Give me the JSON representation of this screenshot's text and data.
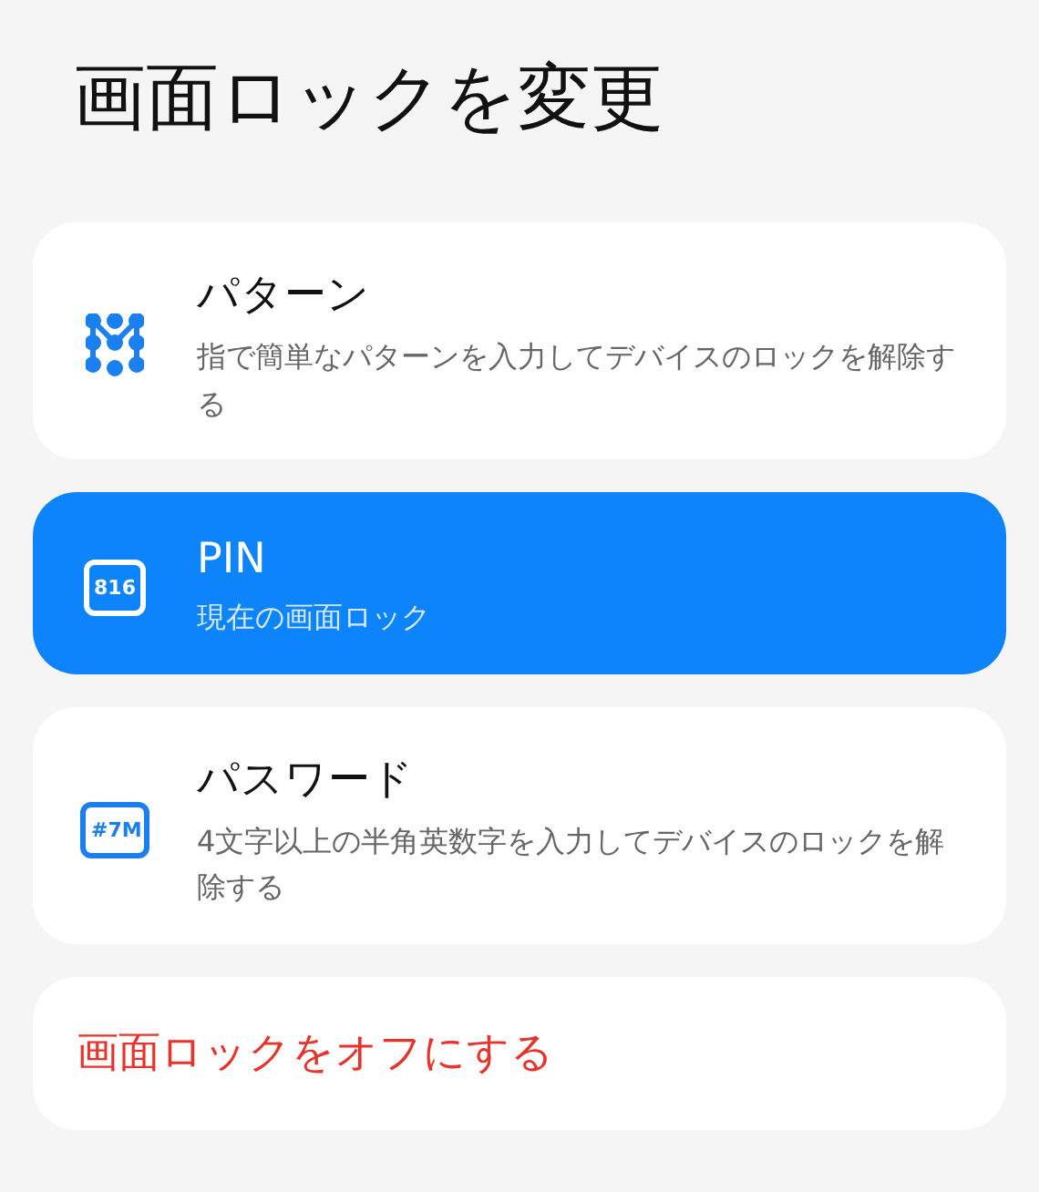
{
  "title": "画面ロックを変更",
  "options": [
    {
      "kind": "pattern",
      "label": "パターン",
      "description": "指で簡単なパターンを入力してデバイスのロックを解除する",
      "selected": false
    },
    {
      "kind": "code",
      "icon_text": "816",
      "label": "PIN",
      "description": "現在の画面ロック",
      "selected": true
    },
    {
      "kind": "code",
      "icon_text": "#7M",
      "label": "パスワード",
      "description": "4文字以上の半角英数字を入力してデバイスのロックを解除する",
      "selected": false
    }
  ],
  "off_action": {
    "label": "画面ロックをオフにする"
  }
}
